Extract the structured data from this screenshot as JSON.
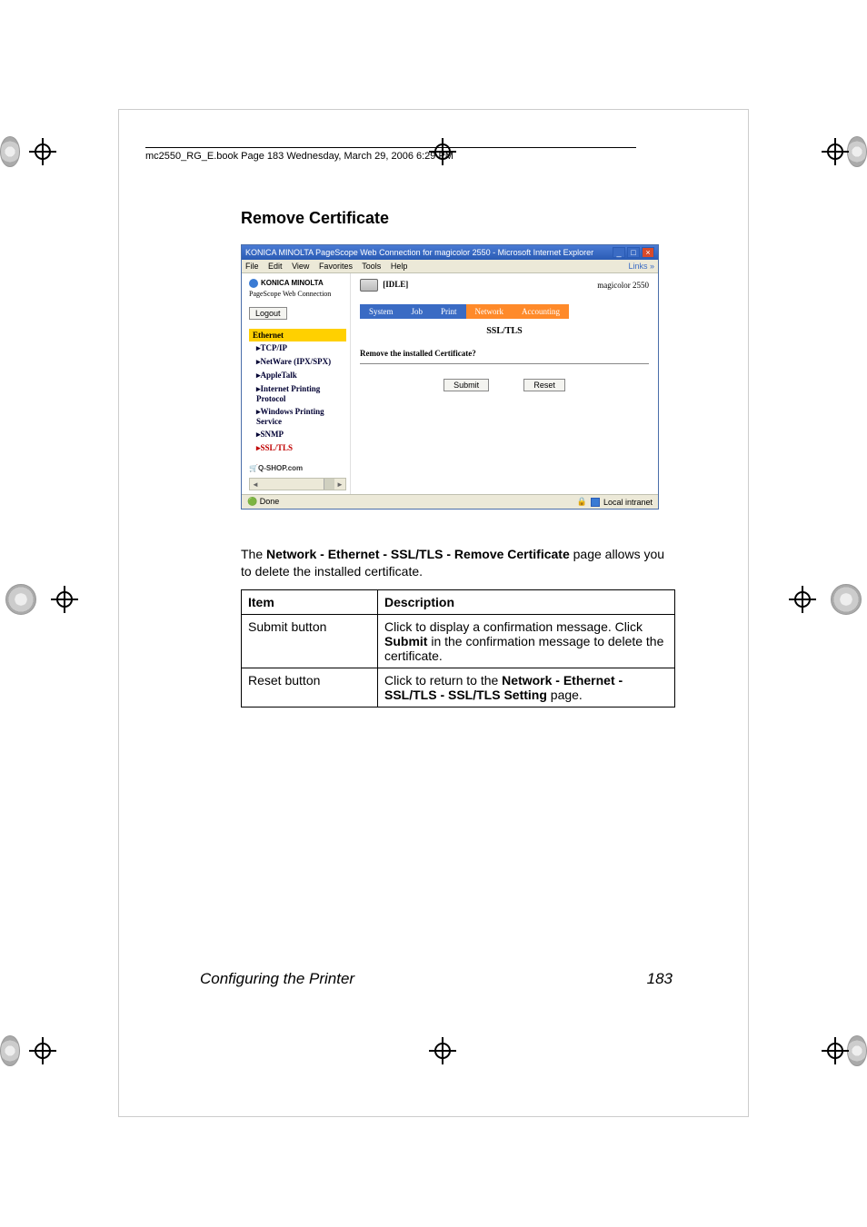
{
  "header_text": "mc2550_RG_E.book  Page 183  Wednesday, March 29, 2006  6:29 PM",
  "section_title": "Remove Certificate",
  "window": {
    "title": "KONICA MINOLTA PageScope Web Connection for magicolor 2550 - Microsoft Internet Explorer",
    "menu": {
      "file": "File",
      "edit": "Edit",
      "view": "View",
      "favorites": "Favorites",
      "tools": "Tools",
      "help": "Help"
    },
    "links_label": "Links",
    "brand": "KONICA MINOLTA",
    "subbrand": "PageScope Web Connection",
    "logout": "Logout",
    "nav": {
      "ethernet": "Ethernet",
      "tcpip": "▸TCP/IP",
      "netware": "▸NetWare (IPX/SPX)",
      "appletalk": "▸AppleTalk",
      "ipp": "▸Internet Printing Protocol",
      "wps": "▸Windows Printing Service",
      "snmp": "▸SNMP",
      "ssl": "▸SSL/TLS"
    },
    "qshop": "Q-SHOP.com",
    "status_label": "[IDLE]",
    "product": "magicolor 2550",
    "tabs": {
      "system": "System",
      "job": "Job",
      "print": "Print",
      "network": "Network",
      "accounting": "Accounting"
    },
    "page_heading": "SSL/TLS",
    "prompt": "Remove the installed Certificate?",
    "submit": "Submit",
    "reset": "Reset",
    "status_done": "Done",
    "zone": "Local intranet"
  },
  "description_intro_pre": "The ",
  "description_intro_bold": "Network - Ethernet - SSL/TLS - Remove Certificate",
  "description_intro_post": " page allows you to delete the installed certificate.",
  "table": {
    "h_item": "Item",
    "h_desc": "Description",
    "r1_item": "Submit button",
    "r1_pre": "Click to display a confirmation message. Click ",
    "r1_bold": "Sub­mit",
    "r1_post": " in the confirmation message to delete the certif­icate.",
    "r2_item": "Reset button",
    "r2_pre": "Click to return to the ",
    "r2_bold": "Network - Ethernet - SSL/TLS - SSL/TLS Setting",
    "r2_post": " page."
  },
  "footer_title": "Configuring the Printer",
  "footer_page": "183"
}
